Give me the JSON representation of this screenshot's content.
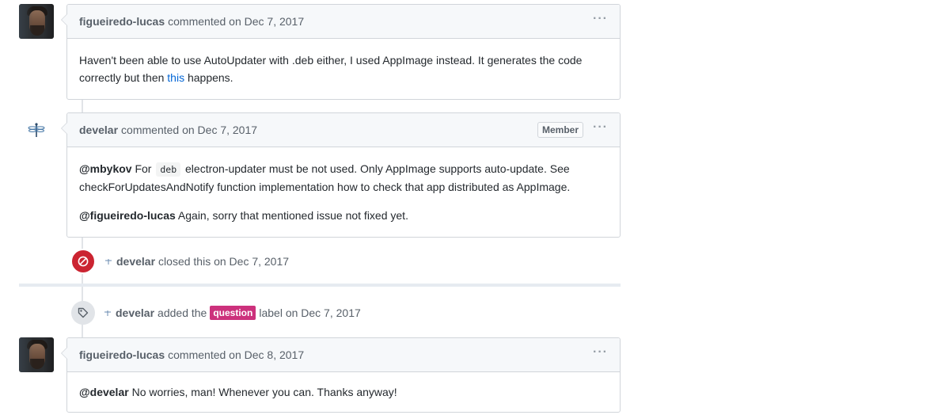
{
  "comments": [
    {
      "author": "figueiredo-lucas",
      "meta": "commented on Dec 7, 2017",
      "body_part1": "Haven't been able to use AutoUpdater with .deb either, I used AppImage instead. It generates the code correctly but then ",
      "body_link": "this",
      "body_part2": " happens."
    },
    {
      "author": "develar",
      "meta": "commented on Dec 7, 2017",
      "badge": "Member",
      "p1_mention": "@mbykov",
      "p1_pre": " For ",
      "p1_code": "deb",
      "p1_post": " electron-updater must be not used. Only AppImage supports auto-update. See checkForUpdatesAndNotify function implementation how to check that app distributed as AppImage.",
      "p2_mention": "@figueiredo-lucas",
      "p2_text": " Again, sorry that mentioned issue not fixed yet."
    },
    {
      "author": "figueiredo-lucas",
      "meta": "commented on Dec 8, 2017",
      "mention": "@develar",
      "text": " No worries, man! Whenever you can. Thanks anyway!"
    }
  ],
  "events": [
    {
      "icon": "circle-slash-icon",
      "actor": "develar",
      "text": "closed this on Dec 7, 2017"
    },
    {
      "icon": "tag-icon",
      "actor": "develar",
      "pre": "added the",
      "label": "question",
      "post": "label on Dec 7, 2017",
      "label_color": "#cc317c"
    }
  ],
  "menu_glyph": "···",
  "colors": {
    "closed_badge": "#cb2431",
    "link": "#0366d6"
  }
}
